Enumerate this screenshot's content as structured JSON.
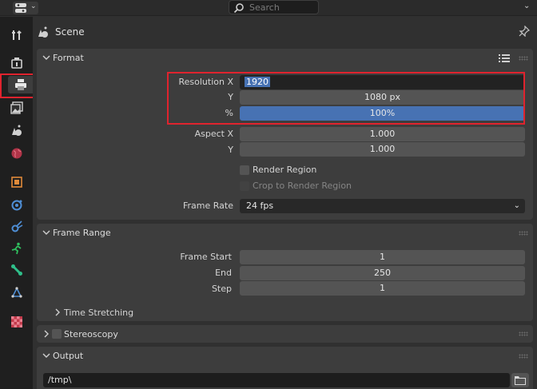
{
  "header": {
    "search_placeholder": "Search"
  },
  "context": {
    "scene_label": "Scene"
  },
  "format": {
    "title": "Format",
    "resolution_x_label": "Resolution X",
    "resolution_x_value": "1920",
    "resolution_y_label": "Y",
    "resolution_y_value": "1080 px",
    "percent_label": "%",
    "percent_value": "100%",
    "aspect_x_label": "Aspect X",
    "aspect_x_value": "1.000",
    "aspect_y_label": "Y",
    "aspect_y_value": "1.000",
    "render_region_label": "Render Region",
    "render_region_checked": false,
    "crop_label": "Crop to Render Region",
    "crop_checked": false,
    "frame_rate_label": "Frame Rate",
    "frame_rate_value": "24 fps"
  },
  "frame_range": {
    "title": "Frame Range",
    "start_label": "Frame Start",
    "start_value": "1",
    "end_label": "End",
    "end_value": "250",
    "step_label": "Step",
    "step_value": "1",
    "time_stretching_label": "Time Stretching"
  },
  "stereoscopy": {
    "title": "Stereoscopy"
  },
  "output": {
    "title": "Output",
    "path_value": "/tmp\\"
  },
  "tabs": [
    {
      "name": "tool-tab",
      "icon": "tool-icon"
    },
    {
      "name": "render-tab",
      "icon": "render-icon"
    },
    {
      "name": "output-tab",
      "icon": "printer-icon",
      "active": true
    },
    {
      "name": "view-layer-tab",
      "icon": "view-layer-icon"
    },
    {
      "name": "scene-tab",
      "icon": "scene-icon"
    },
    {
      "name": "world-tab",
      "icon": "world-icon"
    },
    {
      "name": "object-tab",
      "icon": "object-icon"
    },
    {
      "name": "modifiers-tab",
      "icon": "modifier-icon"
    },
    {
      "name": "particles-tab",
      "icon": "particles-icon"
    },
    {
      "name": "physics-tab",
      "icon": "physics-icon"
    },
    {
      "name": "constraints-tab",
      "icon": "constraint-icon"
    },
    {
      "name": "data-tab",
      "icon": "data-icon"
    },
    {
      "name": "texture-tab",
      "icon": "texture-icon"
    }
  ],
  "colors": {
    "accent": "#4772b3",
    "highlight_box": "#e0232e",
    "panel_bg": "#3d3d3d",
    "field_bg": "#545454"
  }
}
